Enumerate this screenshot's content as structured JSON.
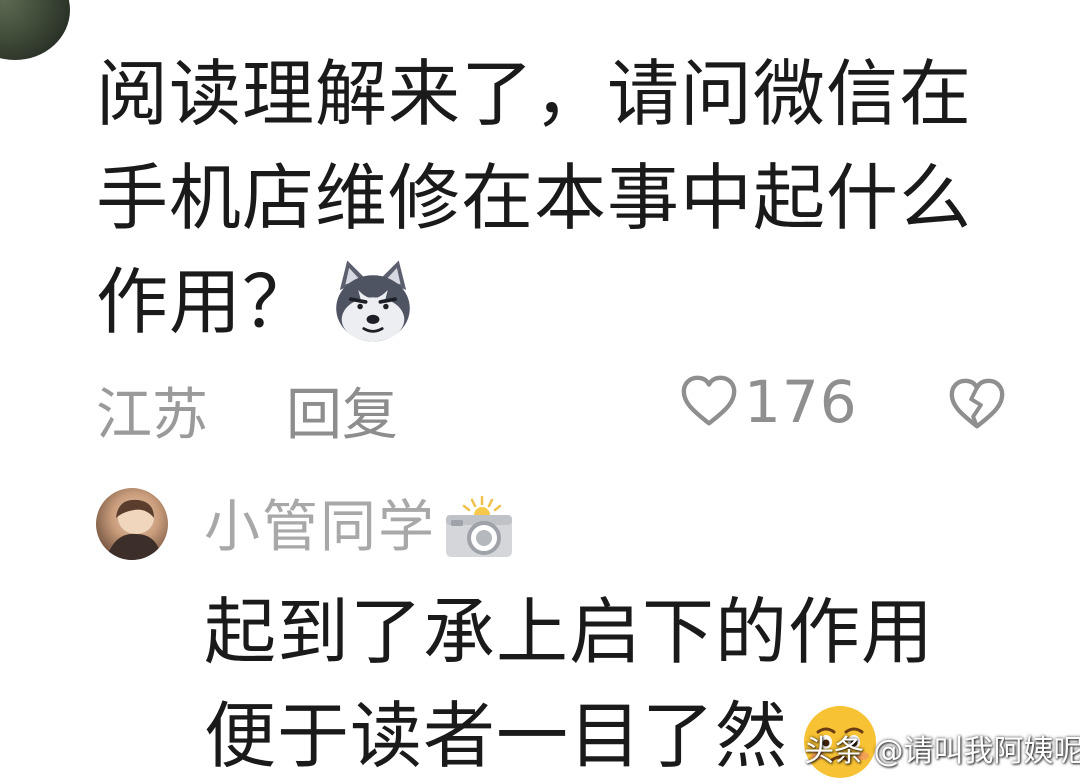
{
  "comment": {
    "lines": [
      "阅读理解来了，请问微信在",
      "手机店维修在本事中起什么",
      "作用？"
    ],
    "emoji": "husky-dog-emoji",
    "location": "江苏",
    "reply_label": "回复",
    "like_count": "176"
  },
  "reply": {
    "username": "小管同学",
    "badge": "camera-icon",
    "lines": [
      "起到了承上启下的作用",
      "便于读者一目了然"
    ],
    "emoji": "grateful-face-emoji"
  },
  "watermark": {
    "text": "头条 @请叫我阿姨呢"
  },
  "colors": {
    "text": "#1a1a1a",
    "meta": "#9a9a9a",
    "username": "#a8a8a8",
    "background": "#ffffff"
  }
}
